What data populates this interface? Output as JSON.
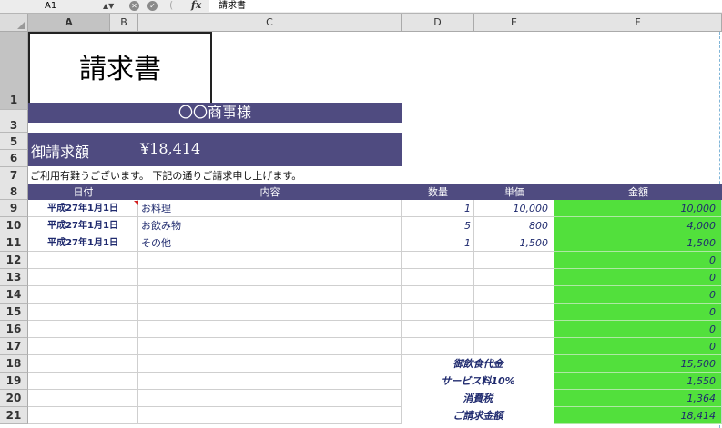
{
  "formula_bar": {
    "name_box": "A1",
    "fx_label": "fx",
    "content": "請求書"
  },
  "columns": [
    "A",
    "B",
    "C",
    "D",
    "E",
    "F"
  ],
  "rows": [
    "1",
    "3",
    "5",
    "6",
    "7",
    "8",
    "9",
    "10",
    "11",
    "12",
    "13",
    "14",
    "15",
    "16",
    "17",
    "18",
    "19",
    "20",
    "21"
  ],
  "sheet": {
    "title": "請求書",
    "customer": "〇〇商事様",
    "amount_label": "御請求額",
    "amount_value": "¥18,414",
    "message": "ご利用有難うございます。 下記の通りご請求申し上げます。",
    "table_headers": {
      "date": "日付",
      "description": "内容",
      "qty": "数量",
      "unit_price": "単価",
      "amount": "金額"
    },
    "items": [
      {
        "date": "平成27年1月1日",
        "description": "お料理",
        "qty": "1",
        "unit_price": "10,000",
        "amount": "10,000"
      },
      {
        "date": "平成27年1月1日",
        "description": "お飲み物",
        "qty": "5",
        "unit_price": "800",
        "amount": "4,000"
      },
      {
        "date": "平成27年1月1日",
        "description": "その他",
        "qty": "1",
        "unit_price": "1,500",
        "amount": "1,500"
      },
      {
        "date": "",
        "description": "",
        "qty": "",
        "unit_price": "",
        "amount": "0"
      },
      {
        "date": "",
        "description": "",
        "qty": "",
        "unit_price": "",
        "amount": "0"
      },
      {
        "date": "",
        "description": "",
        "qty": "",
        "unit_price": "",
        "amount": "0"
      },
      {
        "date": "",
        "description": "",
        "qty": "",
        "unit_price": "",
        "amount": "0"
      },
      {
        "date": "",
        "description": "",
        "qty": "",
        "unit_price": "",
        "amount": "0"
      },
      {
        "date": "",
        "description": "",
        "qty": "",
        "unit_price": "",
        "amount": "0"
      }
    ],
    "summary": [
      {
        "label": "御飲食代金",
        "value": "15,500"
      },
      {
        "label": "サービス料10%",
        "value": "1,550"
      },
      {
        "label": "消費税",
        "value": "1,364"
      },
      {
        "label": "ご請求金額",
        "value": "18,414"
      }
    ]
  },
  "colors": {
    "header_band": "#4f4b80",
    "amount_fill": "#52e03c",
    "data_text": "#1f2a6e"
  }
}
